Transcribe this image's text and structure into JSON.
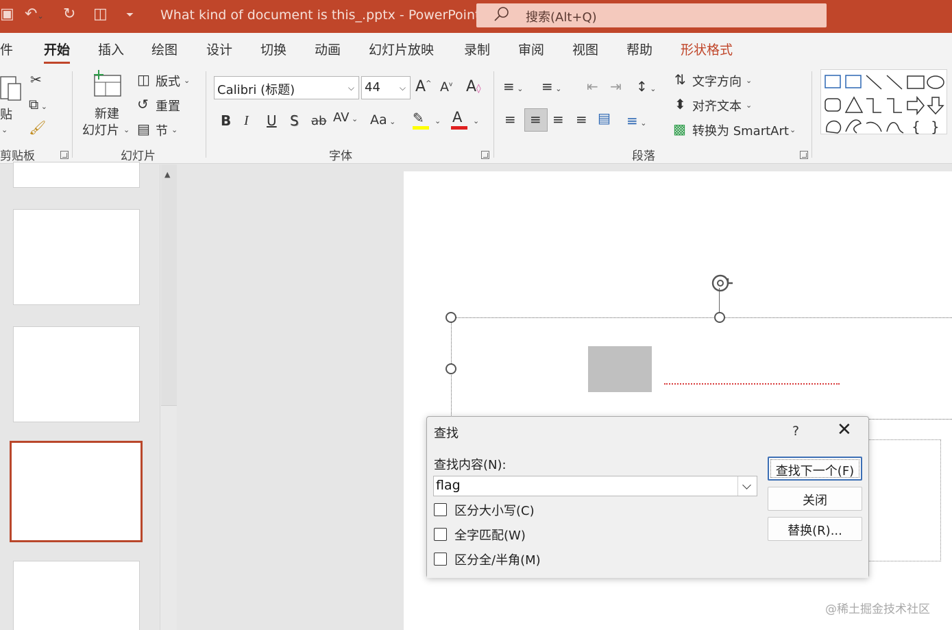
{
  "app": {
    "title": "What kind of document is this_.pptx  -  PowerPoint",
    "search_placeholder": "搜索(Alt+Q)"
  },
  "menu": {
    "tabs": [
      "件",
      "开始",
      "插入",
      "绘图",
      "设计",
      "切换",
      "动画",
      "幻灯片放映",
      "录制",
      "审阅",
      "视图",
      "帮助",
      "形状格式"
    ],
    "active": "开始"
  },
  "ribbon": {
    "clipboard": {
      "paste": "贴",
      "label": "剪贴板"
    },
    "slides": {
      "new_slide_line1": "新建",
      "new_slide_line2": "幻灯片",
      "layout": "版式",
      "reset": "重置",
      "section": "节",
      "label": "幻灯片"
    },
    "font": {
      "name": "Calibri (标题)",
      "size": "44",
      "label": "字体",
      "change_case": "Aa",
      "spacing": "AV",
      "highlight_color": "#ffff00",
      "font_color": "#e02020"
    },
    "paragraph": {
      "text_direction": "文字方向",
      "align_text": "对齐文本",
      "smartart": "转换为 SmartArt",
      "label": "段落"
    }
  },
  "dialog": {
    "title": "查找",
    "help": "?",
    "find_label": "查找内容(N):",
    "find_value": "flag",
    "options": [
      "区分大小写(C)",
      "全字匹配(W)",
      "区分全/半角(M)"
    ],
    "buttons": {
      "find_next": "查找下一个(F)",
      "close": "关闭",
      "replace": "替换(R)..."
    }
  },
  "watermark": "@稀土掘金技术社区",
  "colors": {
    "accent": "#c0462a",
    "selected_thumb": "#b9472b"
  }
}
